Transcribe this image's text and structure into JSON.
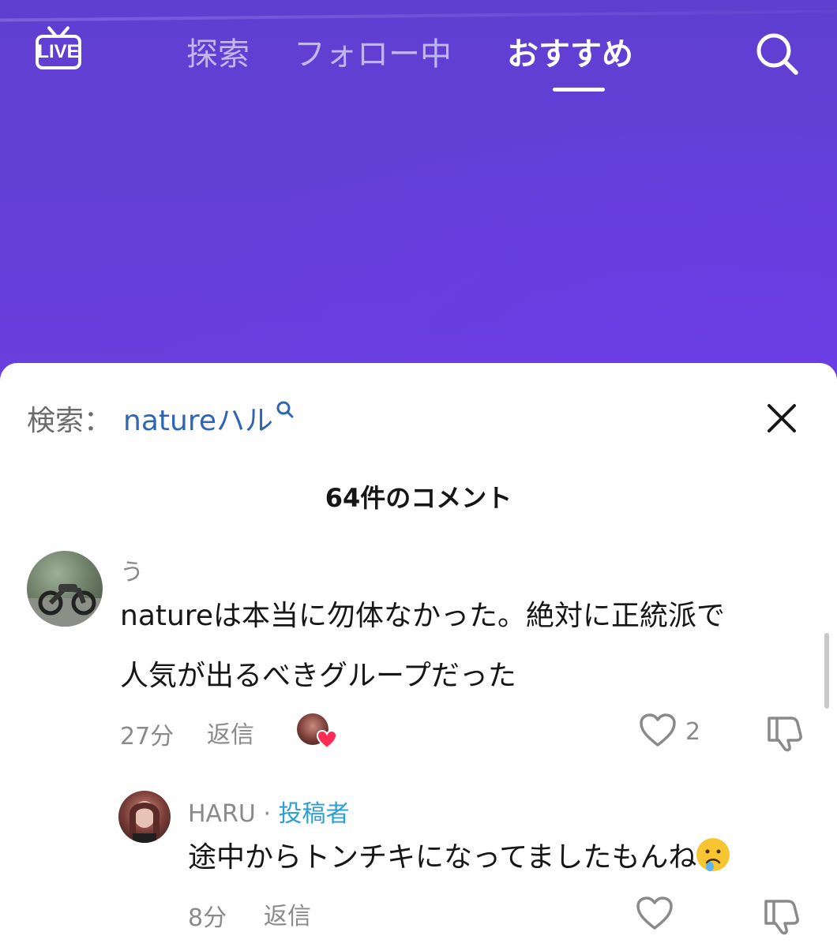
{
  "top_nav": {
    "live_label": "LIVE",
    "tabs": [
      {
        "label": "探索",
        "active": false
      },
      {
        "label": "フォロー中",
        "active": false
      },
      {
        "label": "おすすめ",
        "active": true
      }
    ]
  },
  "sheet": {
    "search_prefix": "検索：",
    "search_term": "natureハル",
    "comment_count": "64件のコメント"
  },
  "comments": [
    {
      "username": "う",
      "text_line1": "natureは本当に勿体なかった。絶対に正統派で",
      "text_line2": "人気が出るべきグループだった",
      "time": "27分",
      "reply_label": "返信",
      "like_count": "2"
    },
    {
      "username": "HARU",
      "separator": "·",
      "author_tag": "投稿者",
      "text": "途中からトンチキになってましたもんね",
      "emoji": "crying-face-emoji",
      "time": "8分",
      "reply_label": "返信"
    }
  ],
  "colors": {
    "video_bg": "#643fd6",
    "author_tag": "#2f9fd0",
    "search_term": "#2f66b3",
    "like_heart_red": "#fe2c55"
  }
}
